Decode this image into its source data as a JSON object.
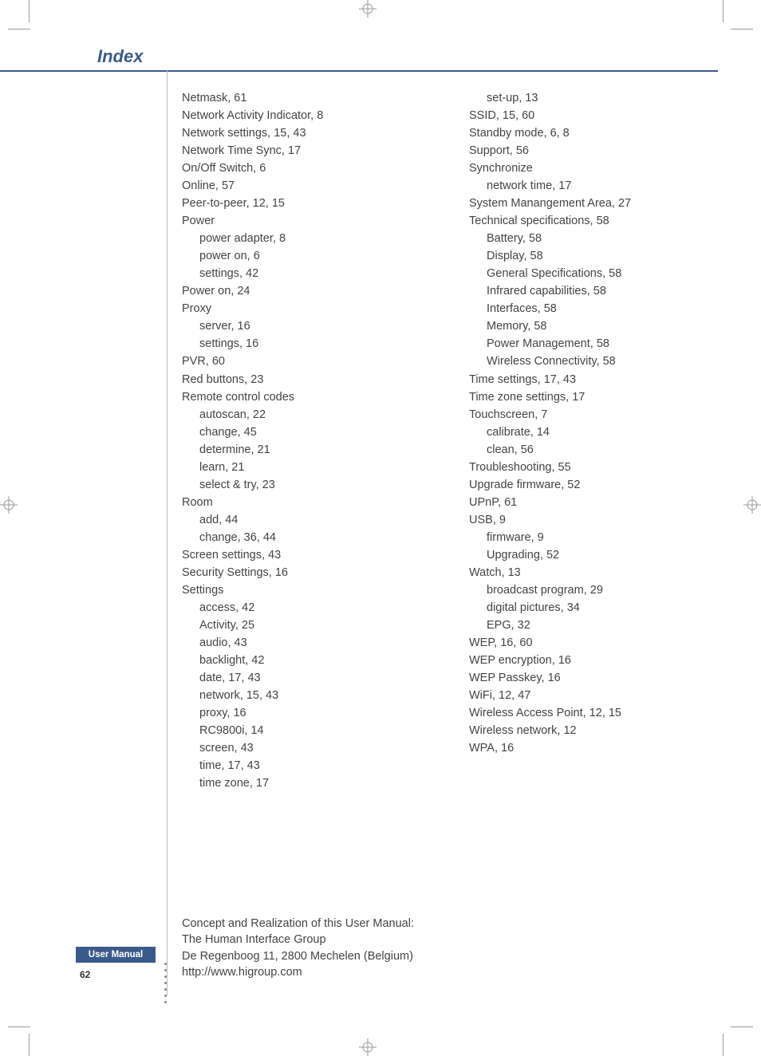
{
  "header": {
    "title": "Index"
  },
  "columns": {
    "left": [
      {
        "t": "Netmask, 61"
      },
      {
        "t": "Network Activity Indicator, 8"
      },
      {
        "t": "Network settings, 15, 43"
      },
      {
        "t": "Network Time Sync, 17"
      },
      {
        "t": "On/Off Switch, 6"
      },
      {
        "t": "Online, 57"
      },
      {
        "t": "Peer-to-peer, 12, 15"
      },
      {
        "t": "Power"
      },
      {
        "t": "power adapter, 8",
        "s": 1
      },
      {
        "t": "power on, 6",
        "s": 1
      },
      {
        "t": "settings, 42",
        "s": 1
      },
      {
        "t": "Power on, 24"
      },
      {
        "t": "Proxy"
      },
      {
        "t": "server, 16",
        "s": 1
      },
      {
        "t": "settings, 16",
        "s": 1
      },
      {
        "t": "PVR, 60"
      },
      {
        "t": "Red buttons, 23"
      },
      {
        "t": "Remote control codes"
      },
      {
        "t": "autoscan, 22",
        "s": 1
      },
      {
        "t": "change, 45",
        "s": 1
      },
      {
        "t": "determine, 21",
        "s": 1
      },
      {
        "t": "learn, 21",
        "s": 1
      },
      {
        "t": "select & try, 23",
        "s": 1
      },
      {
        "t": "Room"
      },
      {
        "t": "add, 44",
        "s": 1
      },
      {
        "t": "change, 36, 44",
        "s": 1
      },
      {
        "t": "Screen settings, 43"
      },
      {
        "t": "Security Settings, 16"
      },
      {
        "t": "Settings"
      },
      {
        "t": "access, 42",
        "s": 1
      },
      {
        "t": "Activity, 25",
        "s": 1
      },
      {
        "t": "audio, 43",
        "s": 1
      },
      {
        "t": "backlight, 42",
        "s": 1
      },
      {
        "t": "date, 17, 43",
        "s": 1
      },
      {
        "t": "network, 15, 43",
        "s": 1
      },
      {
        "t": "proxy, 16",
        "s": 1
      },
      {
        "t": "RC9800i, 14",
        "s": 1
      },
      {
        "t": "screen, 43",
        "s": 1
      },
      {
        "t": "time, 17, 43",
        "s": 1
      },
      {
        "t": "time zone, 17",
        "s": 1
      }
    ],
    "right": [
      {
        "t": "set-up, 13",
        "s": 1
      },
      {
        "t": "SSID, 15, 60"
      },
      {
        "t": "Standby mode, 6, 8"
      },
      {
        "t": "Support, 56"
      },
      {
        "t": "Synchronize"
      },
      {
        "t": "network time, 17",
        "s": 1
      },
      {
        "t": "System Manangement Area, 27"
      },
      {
        "t": "Technical specifications, 58"
      },
      {
        "t": "Battery, 58",
        "s": 1
      },
      {
        "t": "Display, 58",
        "s": 1
      },
      {
        "t": "General Specifications, 58",
        "s": 1
      },
      {
        "t": "Infrared capabilities, 58",
        "s": 1
      },
      {
        "t": "Interfaces, 58",
        "s": 1
      },
      {
        "t": "Memory, 58",
        "s": 1
      },
      {
        "t": "Power Management, 58",
        "s": 1
      },
      {
        "t": "Wireless Connectivity, 58",
        "s": 1
      },
      {
        "t": "Time settings, 17, 43"
      },
      {
        "t": "Time zone settings, 17"
      },
      {
        "t": "Touchscreen, 7"
      },
      {
        "t": "calibrate, 14",
        "s": 1
      },
      {
        "t": "clean, 56",
        "s": 1
      },
      {
        "t": "Troubleshooting, 55"
      },
      {
        "t": "Upgrade firmware, 52"
      },
      {
        "t": "UPnP, 61"
      },
      {
        "t": "USB, 9"
      },
      {
        "t": "firmware, 9",
        "s": 1
      },
      {
        "t": "Upgrading, 52",
        "s": 1
      },
      {
        "t": "Watch, 13"
      },
      {
        "t": "broadcast program, 29",
        "s": 1
      },
      {
        "t": "digital pictures, 34",
        "s": 1
      },
      {
        "t": "EPG, 32",
        "s": 1
      },
      {
        "t": "WEP, 16, 60"
      },
      {
        "t": "WEP encryption, 16"
      },
      {
        "t": "WEP Passkey, 16"
      },
      {
        "t": "WiFi, 12, 47"
      },
      {
        "t": "Wireless Access Point, 12, 15"
      },
      {
        "t": "Wireless network, 12"
      },
      {
        "t": "WPA, 16"
      }
    ]
  },
  "credits": {
    "line1": "Concept and Realization of this User Manual:",
    "line2": "The Human Interface Group",
    "line3": "De Regenboog 11, 2800 Mechelen (Belgium)",
    "line4": "http://www.higroup.com"
  },
  "footer": {
    "label": "User Manual",
    "page": "62"
  }
}
